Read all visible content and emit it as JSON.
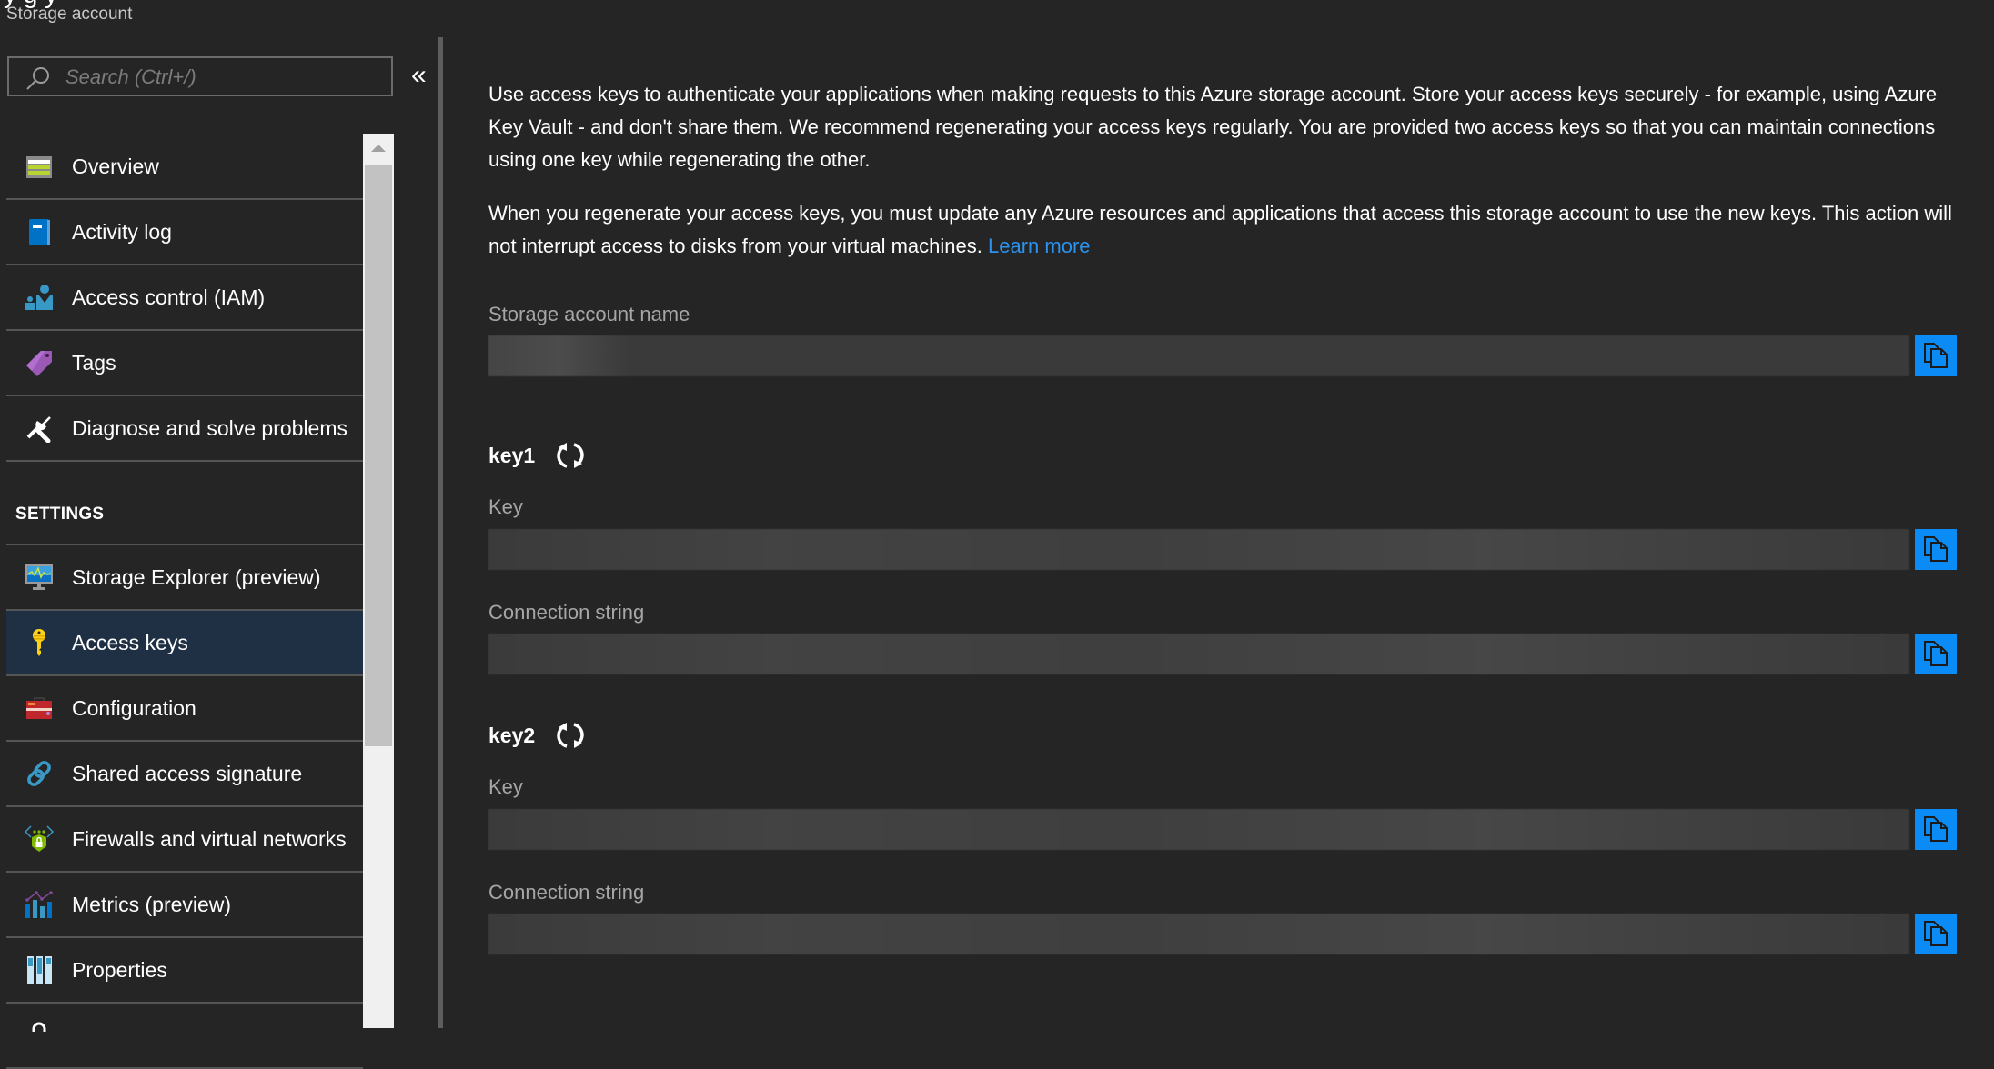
{
  "header": {
    "title_partial": "y                g                         y",
    "subtitle": "Storage account"
  },
  "search": {
    "placeholder": "Search (Ctrl+/)",
    "value": ""
  },
  "collapse_label": "«",
  "menu": {
    "items_top": [
      {
        "label": "Overview",
        "icon": "overview-icon"
      },
      {
        "label": "Activity log",
        "icon": "activity-log-icon"
      },
      {
        "label": "Access control (IAM)",
        "icon": "iam-icon"
      },
      {
        "label": "Tags",
        "icon": "tag-icon"
      },
      {
        "label": "Diagnose and solve problems",
        "icon": "tools-icon"
      }
    ],
    "section_label": "SETTINGS",
    "items_settings": [
      {
        "label": "Storage Explorer (preview)",
        "icon": "storage-explorer-icon"
      },
      {
        "label": "Access keys",
        "icon": "key-icon",
        "selected": true
      },
      {
        "label": "Configuration",
        "icon": "toolbox-icon"
      },
      {
        "label": "Shared access signature",
        "icon": "link-icon"
      },
      {
        "label": "Firewalls and virtual networks",
        "icon": "firewall-icon"
      },
      {
        "label": "Metrics (preview)",
        "icon": "metrics-icon"
      },
      {
        "label": "Properties",
        "icon": "properties-icon"
      }
    ]
  },
  "content": {
    "intro_paragraph": "Use access keys to authenticate your applications when making requests to this Azure storage account. Store your access keys securely - for example, using Azure Key Vault - and don't share them. We recommend regenerating your access keys regularly. You are provided two access keys so that you can maintain connections using one key while regenerating the other.",
    "regenerate_paragraph": "When you regenerate your access keys, you must update any Azure resources and applications that access this storage account to use the new keys. This action will not interrupt access to disks from your virtual machines.",
    "learn_more": "Learn more",
    "storage_account_name_label": "Storage account name",
    "storage_account_name_value": "(redacted)",
    "keys": [
      {
        "heading": "key1",
        "key_label": "Key",
        "key_value": "(redacted)",
        "connection_label": "Connection string",
        "connection_value": "(redacted)"
      },
      {
        "heading": "key2",
        "key_label": "Key",
        "key_value": "(redacted)",
        "connection_label": "Connection string",
        "connection_value": "(redacted)"
      }
    ]
  },
  "colors": {
    "background": "#252525",
    "selected_item": "#1f3044",
    "accent": "#0a8bf5",
    "link": "#2b92ef"
  }
}
